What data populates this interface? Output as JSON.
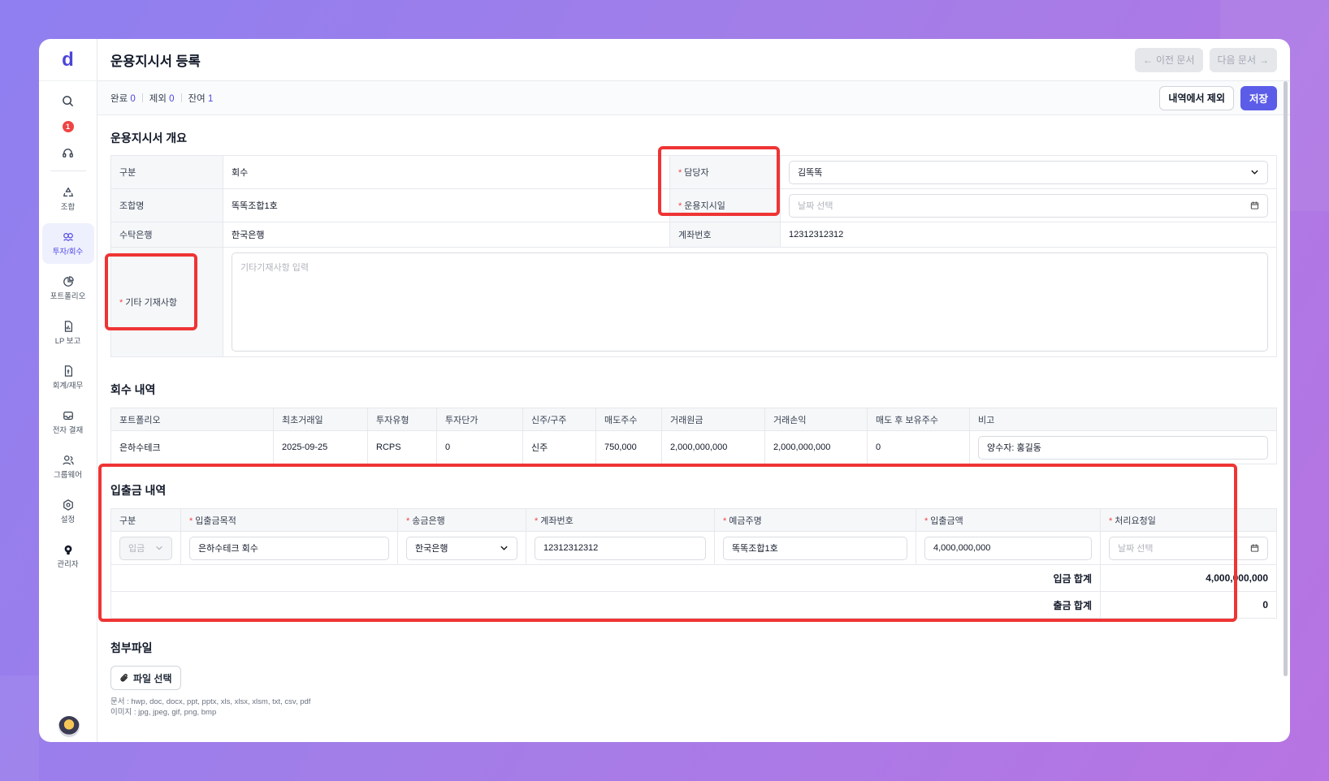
{
  "app": {
    "logo": "d"
  },
  "sidebar": {
    "notif_count": "1",
    "items": [
      {
        "label": "조합",
        "icon": "recycle-icon"
      },
      {
        "label": "투자/회수",
        "icon": "investment-icon"
      },
      {
        "label": "포트폴리오",
        "icon": "pie-chart-icon"
      },
      {
        "label": "LP 보고",
        "icon": "report-icon"
      },
      {
        "label": "회계/재무",
        "icon": "accounting-icon"
      },
      {
        "label": "전자 결재",
        "icon": "inbox-icon"
      },
      {
        "label": "그룹웨어",
        "icon": "users-icon"
      },
      {
        "label": "설정",
        "icon": "settings-icon"
      },
      {
        "label": "관리자",
        "icon": "admin-icon"
      }
    ]
  },
  "header": {
    "title": "운용지시서 등록",
    "prev": "이전 문서",
    "next": "다음 문서"
  },
  "status": {
    "done_label": "완료",
    "done": "0",
    "excl_label": "제외",
    "excl": "0",
    "rem_label": "잔여",
    "rem": "1",
    "exclude_btn": "내역에서 제외",
    "save_btn": "저장"
  },
  "overview": {
    "title": "운용지시서 개요",
    "type_label": "구분",
    "type_value": "회수",
    "manager_label": "담당자",
    "manager_value": "김똑똑",
    "fund_label": "조합명",
    "fund_value": "똑똑조합1호",
    "date_label": "운용지시일",
    "date_placeholder": "날짜 선택",
    "bank_label": "수탁은행",
    "bank_value": "한국은행",
    "account_label": "계좌번호",
    "account_value": "12312312312",
    "notes_label": "기타 기재사항",
    "notes_placeholder": "기타기재사항 입력"
  },
  "recovery": {
    "title": "회수 내역",
    "headers": [
      "포트폴리오",
      "최초거래일",
      "투자유형",
      "투자단가",
      "신주/구주",
      "매도주수",
      "거래원금",
      "거래손익",
      "매도 후 보유주수",
      "비고"
    ],
    "row": [
      "은하수테크",
      "2025-09-25",
      "RCPS",
      "0",
      "신주",
      "750,000",
      "2,000,000,000",
      "2,000,000,000",
      "0"
    ],
    "note": "양수자: 홍길동"
  },
  "cashflow": {
    "title": "입출금 내역",
    "headers": [
      "구분",
      "입출금목적",
      "송금은행",
      "계좌번호",
      "예금주명",
      "입출금액",
      "처리요청일"
    ],
    "type": "입금",
    "purpose": "은하수테크 회수",
    "bank": "한국은행",
    "account": "12312312312",
    "holder": "똑똑조합1호",
    "amount": "4,000,000,000",
    "date_placeholder": "날짜 선택",
    "in_total_label": "입금 합계",
    "in_total": "4,000,000,000",
    "out_total_label": "출금 합계",
    "out_total": "0"
  },
  "attachment": {
    "title": "첨부파일",
    "button": "파일 선택",
    "doc_hint": "문서 : hwp, doc, docx, ppt, pptx, xls, xlsx, xlsm, txt, csv, pdf",
    "img_hint": "이미지 : jpg, jpeg, gif, png, bmp"
  },
  "colors": {
    "accent": "#5b5ce8",
    "highlight": "#ef3434",
    "required": "#ef4444"
  }
}
